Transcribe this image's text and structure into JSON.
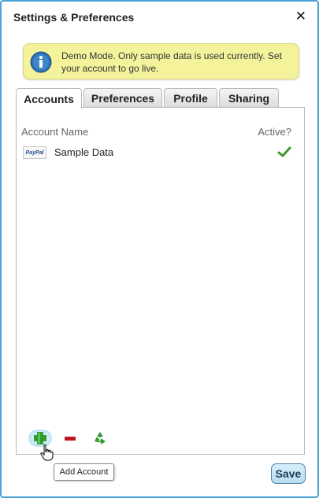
{
  "dialog": {
    "title": "Settings & Preferences",
    "close_glyph": "✕"
  },
  "notice": {
    "icon": "info-icon",
    "text": "Demo Mode. Only sample data is used currently. Set your account to go live."
  },
  "tabs": [
    {
      "label": "Accounts",
      "active": true
    },
    {
      "label": "Preferences",
      "active": false
    },
    {
      "label": "Profile",
      "active": false
    },
    {
      "label": "Sharing",
      "active": false
    }
  ],
  "accounts_table": {
    "columns": [
      "Account Name",
      "Active?"
    ],
    "rows": [
      {
        "logo_text": "PayPal",
        "name": "Sample Data",
        "active": true
      }
    ]
  },
  "toolbar": {
    "add_icon": "plus-icon",
    "remove_icon": "minus-icon",
    "reset_icon": "recycle-icon",
    "tooltip": "Add Account"
  },
  "footer": {
    "save_label": "Save"
  },
  "colors": {
    "window_border": "#4aa3d8",
    "notice_bg": "#f4f39c",
    "add_green": "#2e9c2e",
    "remove_red": "#c0141b",
    "check_green": "#3c9a2b"
  }
}
